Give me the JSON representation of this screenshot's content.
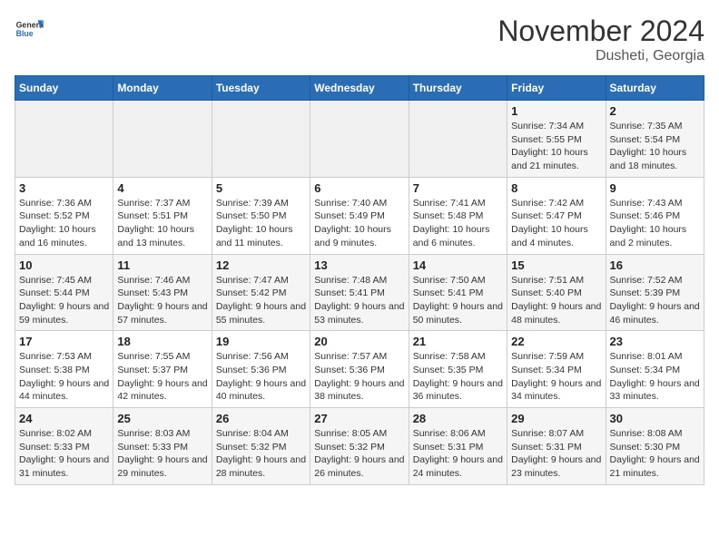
{
  "header": {
    "logo_general": "General",
    "logo_blue": "Blue",
    "month": "November 2024",
    "location": "Dusheti, Georgia"
  },
  "weekdays": [
    "Sunday",
    "Monday",
    "Tuesday",
    "Wednesday",
    "Thursday",
    "Friday",
    "Saturday"
  ],
  "weeks": [
    [
      {
        "day": "",
        "info": ""
      },
      {
        "day": "",
        "info": ""
      },
      {
        "day": "",
        "info": ""
      },
      {
        "day": "",
        "info": ""
      },
      {
        "day": "",
        "info": ""
      },
      {
        "day": "1",
        "info": "Sunrise: 7:34 AM\nSunset: 5:55 PM\nDaylight: 10 hours and 21 minutes."
      },
      {
        "day": "2",
        "info": "Sunrise: 7:35 AM\nSunset: 5:54 PM\nDaylight: 10 hours and 18 minutes."
      }
    ],
    [
      {
        "day": "3",
        "info": "Sunrise: 7:36 AM\nSunset: 5:52 PM\nDaylight: 10 hours and 16 minutes."
      },
      {
        "day": "4",
        "info": "Sunrise: 7:37 AM\nSunset: 5:51 PM\nDaylight: 10 hours and 13 minutes."
      },
      {
        "day": "5",
        "info": "Sunrise: 7:39 AM\nSunset: 5:50 PM\nDaylight: 10 hours and 11 minutes."
      },
      {
        "day": "6",
        "info": "Sunrise: 7:40 AM\nSunset: 5:49 PM\nDaylight: 10 hours and 9 minutes."
      },
      {
        "day": "7",
        "info": "Sunrise: 7:41 AM\nSunset: 5:48 PM\nDaylight: 10 hours and 6 minutes."
      },
      {
        "day": "8",
        "info": "Sunrise: 7:42 AM\nSunset: 5:47 PM\nDaylight: 10 hours and 4 minutes."
      },
      {
        "day": "9",
        "info": "Sunrise: 7:43 AM\nSunset: 5:46 PM\nDaylight: 10 hours and 2 minutes."
      }
    ],
    [
      {
        "day": "10",
        "info": "Sunrise: 7:45 AM\nSunset: 5:44 PM\nDaylight: 9 hours and 59 minutes."
      },
      {
        "day": "11",
        "info": "Sunrise: 7:46 AM\nSunset: 5:43 PM\nDaylight: 9 hours and 57 minutes."
      },
      {
        "day": "12",
        "info": "Sunrise: 7:47 AM\nSunset: 5:42 PM\nDaylight: 9 hours and 55 minutes."
      },
      {
        "day": "13",
        "info": "Sunrise: 7:48 AM\nSunset: 5:41 PM\nDaylight: 9 hours and 53 minutes."
      },
      {
        "day": "14",
        "info": "Sunrise: 7:50 AM\nSunset: 5:41 PM\nDaylight: 9 hours and 50 minutes."
      },
      {
        "day": "15",
        "info": "Sunrise: 7:51 AM\nSunset: 5:40 PM\nDaylight: 9 hours and 48 minutes."
      },
      {
        "day": "16",
        "info": "Sunrise: 7:52 AM\nSunset: 5:39 PM\nDaylight: 9 hours and 46 minutes."
      }
    ],
    [
      {
        "day": "17",
        "info": "Sunrise: 7:53 AM\nSunset: 5:38 PM\nDaylight: 9 hours and 44 minutes."
      },
      {
        "day": "18",
        "info": "Sunrise: 7:55 AM\nSunset: 5:37 PM\nDaylight: 9 hours and 42 minutes."
      },
      {
        "day": "19",
        "info": "Sunrise: 7:56 AM\nSunset: 5:36 PM\nDaylight: 9 hours and 40 minutes."
      },
      {
        "day": "20",
        "info": "Sunrise: 7:57 AM\nSunset: 5:36 PM\nDaylight: 9 hours and 38 minutes."
      },
      {
        "day": "21",
        "info": "Sunrise: 7:58 AM\nSunset: 5:35 PM\nDaylight: 9 hours and 36 minutes."
      },
      {
        "day": "22",
        "info": "Sunrise: 7:59 AM\nSunset: 5:34 PM\nDaylight: 9 hours and 34 minutes."
      },
      {
        "day": "23",
        "info": "Sunrise: 8:01 AM\nSunset: 5:34 PM\nDaylight: 9 hours and 33 minutes."
      }
    ],
    [
      {
        "day": "24",
        "info": "Sunrise: 8:02 AM\nSunset: 5:33 PM\nDaylight: 9 hours and 31 minutes."
      },
      {
        "day": "25",
        "info": "Sunrise: 8:03 AM\nSunset: 5:33 PM\nDaylight: 9 hours and 29 minutes."
      },
      {
        "day": "26",
        "info": "Sunrise: 8:04 AM\nSunset: 5:32 PM\nDaylight: 9 hours and 28 minutes."
      },
      {
        "day": "27",
        "info": "Sunrise: 8:05 AM\nSunset: 5:32 PM\nDaylight: 9 hours and 26 minutes."
      },
      {
        "day": "28",
        "info": "Sunrise: 8:06 AM\nSunset: 5:31 PM\nDaylight: 9 hours and 24 minutes."
      },
      {
        "day": "29",
        "info": "Sunrise: 8:07 AM\nSunset: 5:31 PM\nDaylight: 9 hours and 23 minutes."
      },
      {
        "day": "30",
        "info": "Sunrise: 8:08 AM\nSunset: 5:30 PM\nDaylight: 9 hours and 21 minutes."
      }
    ]
  ]
}
